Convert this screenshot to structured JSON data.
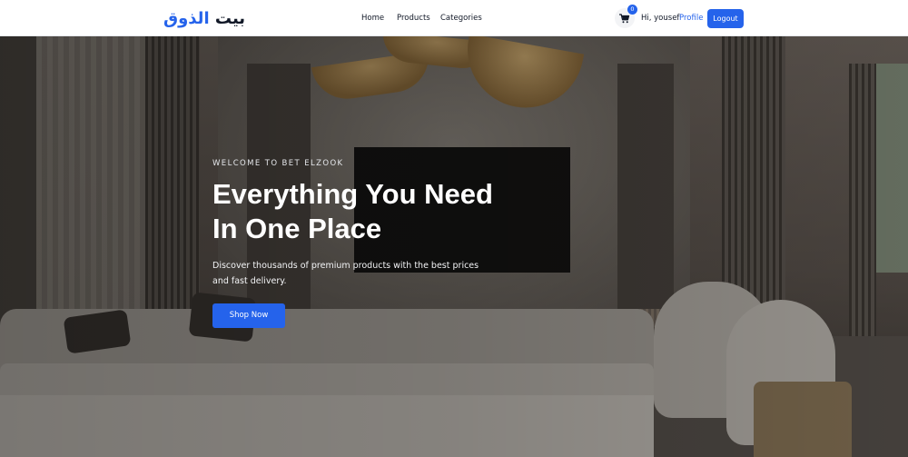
{
  "navbar": {
    "logo_word1": "بيت",
    "logo_word2": "الذوق",
    "links": [
      {
        "label": "Home"
      },
      {
        "label": "Products"
      },
      {
        "label": "Categories"
      }
    ],
    "cart_count": "0",
    "greeting": "Hi, yousef",
    "profile_label": "Profile",
    "logout_label": "Logout"
  },
  "hero": {
    "eyebrow": "WELCOME TO BET ELZOOK",
    "headline_line1": "Everything You Need",
    "headline_line2": "In One Place",
    "subtext_line1": "Discover thousands of premium products with the best prices",
    "subtext_line2": "and fast delivery.",
    "cta_label": "Shop Now"
  },
  "colors": {
    "accent": "#2563eb",
    "navbar_bg": "#ffffff",
    "hero_text": "#ffffff"
  },
  "icons": {
    "cart": "shopping-cart-icon"
  }
}
